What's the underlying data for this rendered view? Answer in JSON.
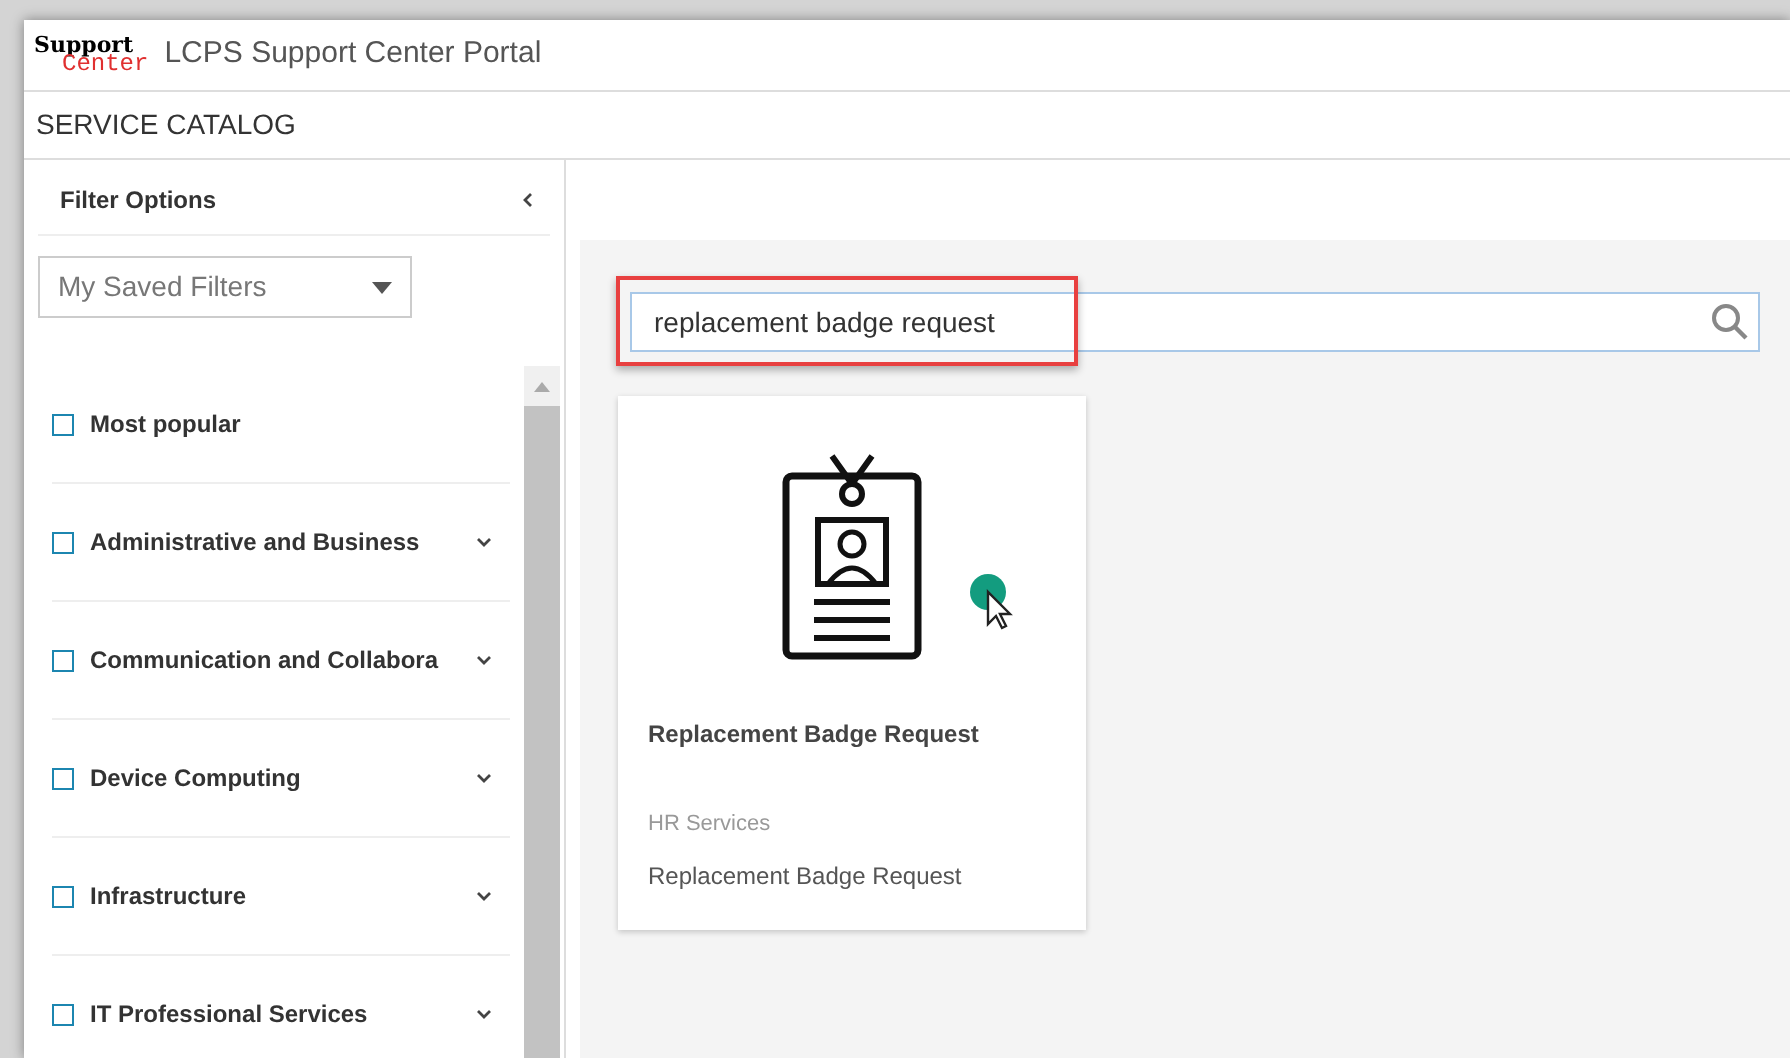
{
  "header": {
    "logo_top": "Support",
    "logo_bottom": "Center",
    "title": "LCPS Support Center Portal"
  },
  "page_title": "SERVICE CATALOG",
  "filters": {
    "title": "Filter Options",
    "saved_filters": {
      "value": "My Saved Filters"
    },
    "categories": [
      {
        "label": "Most popular",
        "checked": false,
        "expandable": false
      },
      {
        "label": "Administrative and Business",
        "checked": false,
        "expandable": true
      },
      {
        "label": "Communication and Collabora",
        "checked": false,
        "expandable": true
      },
      {
        "label": "Device Computing",
        "checked": false,
        "expandable": true
      },
      {
        "label": "Infrastructure",
        "checked": false,
        "expandable": true
      },
      {
        "label": "IT Professional Services",
        "checked": false,
        "expandable": true
      }
    ]
  },
  "search": {
    "value": "replacement badge request",
    "highlighted": true
  },
  "results": [
    {
      "title": "Replacement Badge Request",
      "category": "HR Services",
      "description": "Replacement Badge Request"
    }
  ]
}
